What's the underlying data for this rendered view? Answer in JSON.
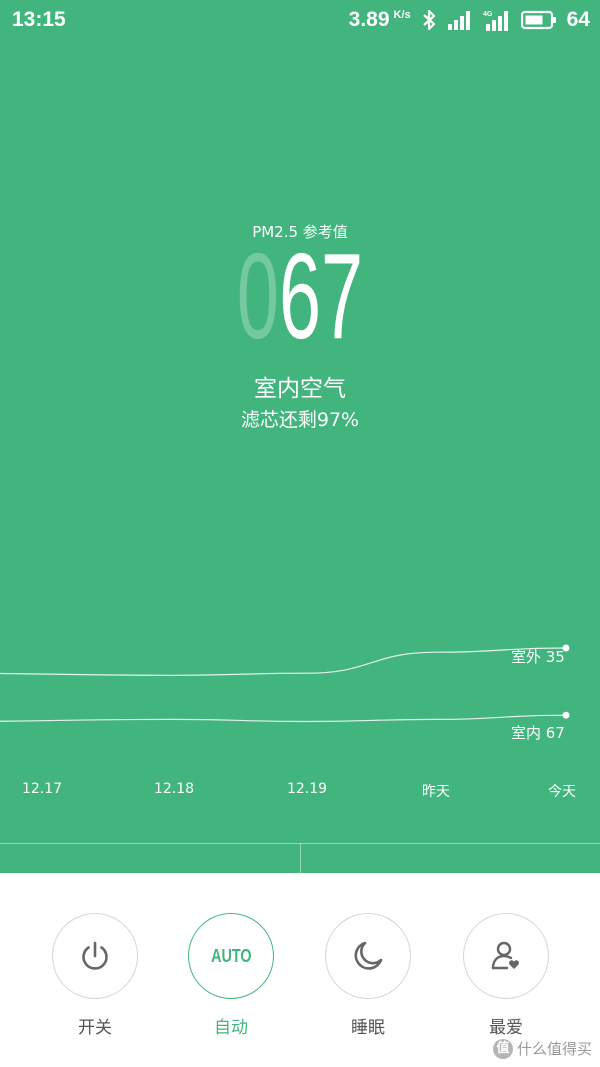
{
  "status_bar": {
    "time": "13:15",
    "net_speed": "3.89",
    "net_unit": "K/s",
    "network_type": "4G",
    "battery": "64",
    "icons": [
      "bluetooth-icon",
      "signal-icon",
      "signal-4g-icon",
      "battery-icon"
    ]
  },
  "pm": {
    "label": "PM2.5 参考值",
    "lead_digit": "0",
    "value": "67"
  },
  "air": {
    "title": "室内空气",
    "filter_remaining": "滤芯还剩97%"
  },
  "chart_data": {
    "type": "line",
    "x": [
      "12.17",
      "12.18",
      "12.19",
      "昨天",
      "今天"
    ],
    "series": [
      {
        "name": "室外",
        "values": [
          47,
          48,
          47,
          37,
          35
        ],
        "color": "#ffffff"
      },
      {
        "name": "室内",
        "values": [
          70,
          69,
          70,
          69,
          67
        ],
        "color": "#ffffff"
      }
    ],
    "end_labels": {
      "outdoor": "室外 35",
      "indoor": "室内 67"
    },
    "grid": false
  },
  "controls": [
    {
      "label": "开关",
      "icon": "power-icon",
      "active": false
    },
    {
      "label": "自动",
      "icon_text": "AUTO",
      "active": true
    },
    {
      "label": "睡眠",
      "icon": "moon-icon",
      "active": false
    },
    {
      "label": "最爱",
      "icon": "favorite-user-icon",
      "active": false
    }
  ],
  "watermark": {
    "badge": "值",
    "text": "什么值得买"
  },
  "colors": {
    "accent": "#41b57d",
    "text_gray": "#555555"
  }
}
